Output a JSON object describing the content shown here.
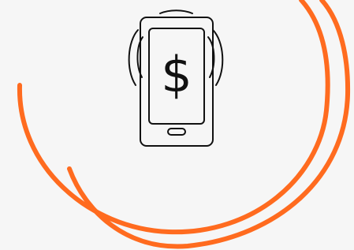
{
  "illustration": {
    "glyph": "$",
    "accent_color": "#ff6b1f",
    "line_color": "#111111",
    "background_color": "#f6f6f6",
    "icon": "contactless-payment-phone-icon"
  }
}
